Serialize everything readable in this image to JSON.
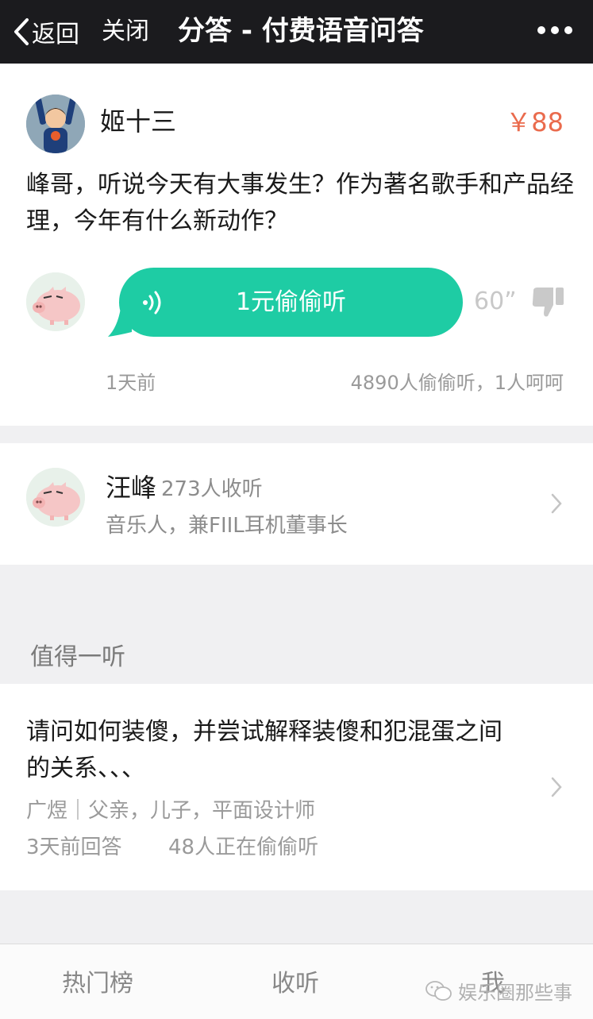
{
  "nav": {
    "back_label": "返回",
    "close_label": "关闭",
    "title": "分答 - 付费语音问答"
  },
  "question": {
    "asker_name": "姬十三",
    "price": "￥88",
    "text": "峰哥，听说今天有大事发生？作为著名歌手和产品经理，今年有什么新动作？",
    "voice_button": "1元偷偷听",
    "duration": "60”",
    "time_ago": "1天前",
    "stats": "4890人偷偷听，1人呵呵"
  },
  "answerer": {
    "name": "汪峰",
    "listeners": "273人收听",
    "description": "音乐人，兼FIIL耳机董事长"
  },
  "recommend": {
    "section_title": "值得一听",
    "items": [
      {
        "question": "请问如何装傻，并尝试解释装傻和犯混蛋之间的关系、、、",
        "author": "广煜｜父亲，儿子，平面设计师",
        "time": "3天前回答",
        "listening": "48人正在偷偷听"
      }
    ]
  },
  "tabs": [
    "热门榜",
    "收听",
    "我"
  ],
  "watermark": "娱乐圈那些事",
  "colors": {
    "accent_green": "#1ecca4",
    "price_red": "#ea6b4d",
    "header_bg": "#1b1b1e"
  },
  "icons": [
    "back-chevron-icon",
    "more-dots-icon",
    "sound-wave-icon",
    "thumbs-down-icon",
    "chevron-right-icon",
    "wechat-icon"
  ]
}
